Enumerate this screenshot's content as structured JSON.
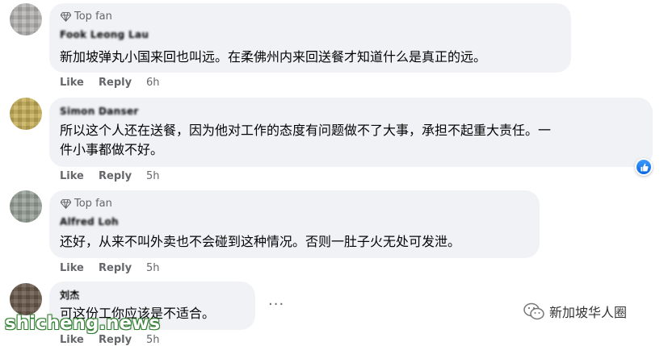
{
  "comments": [
    {
      "badge": "Top fan",
      "author": "Fook Leong Lau",
      "text": [
        "新加坡弹丸小国来回也叫远。在柔佛州内来回送餐才知道什么是真正的远。"
      ],
      "like": "Like",
      "reply": "Reply",
      "time": "6h"
    },
    {
      "badge": "",
      "author": "Simon Danser",
      "text": [
        "所以这个人还在送餐，因为他对工作的态度有问题做不了大事，承担不起重大责任。一",
        "件小事都做不好。"
      ],
      "like": "Like",
      "reply": "Reply",
      "time": "5h",
      "reaction": "like-reaction-icon"
    },
    {
      "badge": "Top fan",
      "author": "Alfred Loh",
      "text": [
        "还好，从来不叫外卖也不会碰到这种情况。否则一肚子火无处可发泄。"
      ],
      "like": "Like",
      "reply": "Reply",
      "time": "5h"
    },
    {
      "badge": "",
      "author": "刘杰",
      "text": [
        "可这份工你应该是不适合。"
      ],
      "like": "Like",
      "reply": "Reply",
      "time": "5h",
      "more": "···"
    }
  ],
  "watermark": {
    "site": "shicheng.news",
    "brand": "新加坡华人圈"
  },
  "colors": {
    "bubble": "#f0f2f5",
    "meta": "#65676b",
    "like_blue": "#1877f2",
    "watermark_green": "#2f7d2f"
  }
}
